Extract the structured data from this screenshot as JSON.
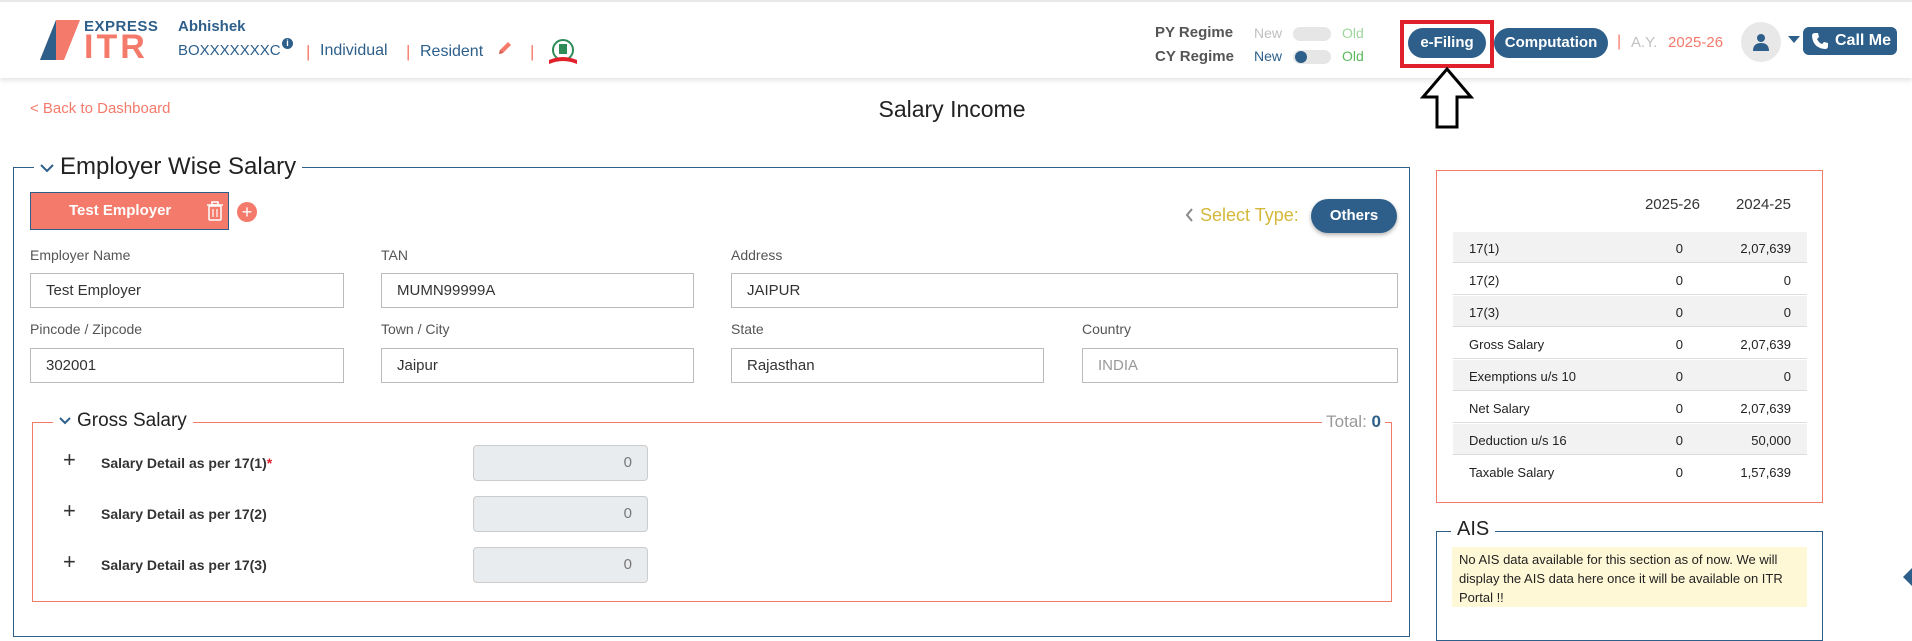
{
  "header": {
    "logo_top": "EXPRESS",
    "logo_bottom": "ITR",
    "user_name": "Abhishek",
    "pan": "BOXXXXXXXC",
    "pan_info": "i",
    "separator": "|",
    "user_type": "Individual",
    "residency": "Resident",
    "py_regime_label": "PY Regime",
    "cy_regime_label": "CY Regime",
    "regime_new": "New",
    "regime_old": "Old",
    "efiling_label": "e-Filing",
    "computation_label": "Computation",
    "ay_label": "A.Y.",
    "ay_value": "2025-26",
    "call_me_label": "Call Me",
    "colors": {
      "brand_blue": "#2d5f8a",
      "brand_coral": "#f47a6b",
      "highlight_red": "#e0202a",
      "old_green": "#5cb85c"
    }
  },
  "page": {
    "back_link": "< Back to Dashboard",
    "title": "Salary Income"
  },
  "employer": {
    "section_title": "Employer Wise Salary",
    "tab_label": "Test Employer",
    "select_type_label": "Select Type:",
    "type_value": "Others",
    "fields": {
      "employer_name_label": "Employer Name",
      "employer_name_value": "Test Employer",
      "tan_label": "TAN",
      "tan_value": "MUMN99999A",
      "address_label": "Address",
      "address_value": "JAIPUR",
      "pincode_label": "Pincode / Zipcode",
      "pincode_value": "302001",
      "town_label": "Town / City",
      "town_value": "Jaipur",
      "state_label": "State",
      "state_value": "Rajasthan",
      "country_label": "Country",
      "country_value": "INDIA"
    }
  },
  "gross_salary": {
    "title": "Gross Salary",
    "total_label": "Total:",
    "total_value": "0",
    "rows": [
      {
        "label": "Salary Detail as per 17(1)",
        "required": "*",
        "value": "0"
      },
      {
        "label": "Salary Detail as per 17(2)",
        "value": "0"
      },
      {
        "label": "Salary Detail as per 17(3)",
        "value": "0"
      }
    ]
  },
  "summary": {
    "columns": [
      "2025-26",
      "2024-25"
    ],
    "rows": [
      {
        "label": "17(1)",
        "cy": "0",
        "py": "2,07,639"
      },
      {
        "label": "17(2)",
        "cy": "0",
        "py": "0"
      },
      {
        "label": "17(3)",
        "cy": "0",
        "py": "0"
      },
      {
        "label": "Gross Salary",
        "cy": "0",
        "py": "2,07,639"
      },
      {
        "label": "Exemptions u/s 10",
        "cy": "0",
        "py": "0"
      },
      {
        "label": "Net Salary",
        "cy": "0",
        "py": "2,07,639"
      },
      {
        "label": "Deduction u/s 16",
        "cy": "0",
        "py": "50,000"
      },
      {
        "label": "Taxable Salary",
        "cy": "0",
        "py": "1,57,639"
      }
    ]
  },
  "ais": {
    "title": "AIS",
    "message": "No AIS data available for this section as of now. We will display the AIS data here once it will be available on ITR Portal !!"
  }
}
